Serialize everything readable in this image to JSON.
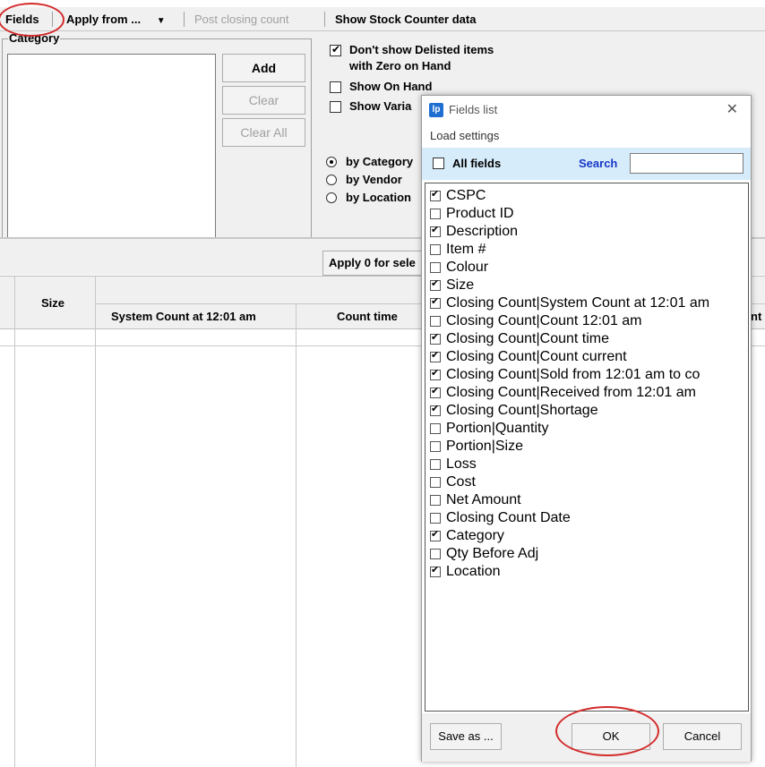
{
  "toolbar": {
    "fields": "Fields",
    "apply_from": "Apply from ...",
    "post_closing_count": "Post closing count",
    "show_stock_counter": "Show Stock Counter data"
  },
  "category": {
    "label": "Category",
    "add": "Add",
    "clear": "Clear",
    "clear_all": "Clear All"
  },
  "options": {
    "dont_show_delisted_1": "Don't show Delisted items",
    "dont_show_delisted_2": "with Zero on Hand",
    "show_on_hand": "Show On Hand",
    "show_variance": "Show Varia",
    "by_category": "by Category",
    "by_vendor": "by Vendor",
    "by_location": "by Location"
  },
  "apply_button": "Apply 0 for sele",
  "grid": {
    "size": "Size",
    "system_count": "System Count at 12:01 am",
    "count_time": "Count time",
    "nt": "nt"
  },
  "dialog": {
    "title": "Fields list",
    "icon": "lp",
    "load_settings": "Load settings",
    "all_fields": "All fields",
    "search_label": "Search",
    "search_value": "",
    "save_as": "Save as ...",
    "ok": "OK",
    "cancel": "Cancel",
    "fields": [
      {
        "label": "CSPC",
        "checked": true
      },
      {
        "label": "Product ID",
        "checked": false
      },
      {
        "label": "Description",
        "checked": true
      },
      {
        "label": "Item #",
        "checked": false
      },
      {
        "label": "Colour",
        "checked": false
      },
      {
        "label": "Size",
        "checked": true
      },
      {
        "label": "Closing Count|System Count at 12:01 am",
        "checked": true
      },
      {
        "label": "Closing Count|Count 12:01 am",
        "checked": false
      },
      {
        "label": "Closing Count|Count time",
        "checked": true
      },
      {
        "label": "Closing Count|Count current",
        "checked": true
      },
      {
        "label": "Closing Count|Sold from 12:01 am to co",
        "checked": true
      },
      {
        "label": "Closing Count|Received from 12:01 am",
        "checked": true
      },
      {
        "label": "Closing Count|Shortage",
        "checked": true
      },
      {
        "label": "Portion|Quantity",
        "checked": false
      },
      {
        "label": "Portion|Size",
        "checked": false
      },
      {
        "label": "Loss",
        "checked": false
      },
      {
        "label": "Cost",
        "checked": false
      },
      {
        "label": "Net Amount",
        "checked": false
      },
      {
        "label": "Closing Count Date",
        "checked": false
      },
      {
        "label": "Category",
        "checked": true
      },
      {
        "label": "Qty Before Adj",
        "checked": false
      },
      {
        "label": "Location",
        "checked": true
      }
    ]
  },
  "colors": {
    "highlight": "#d42a2a",
    "search": "#1737c9",
    "filter_bar": "#d6ecfa"
  }
}
